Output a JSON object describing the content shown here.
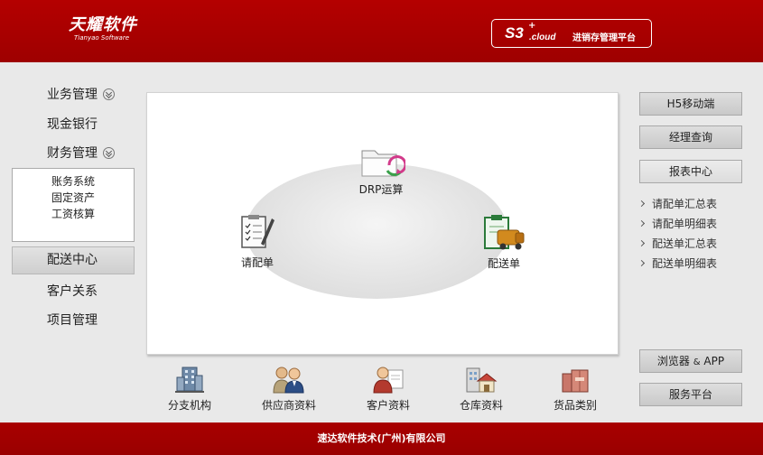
{
  "header": {
    "logo_main": "天耀软件",
    "logo_sub": "Tianyao Software",
    "brand_s3": "S3",
    "brand_plus": "+",
    "brand_cloud": ".cloud",
    "brand_text": "进销存管理平台"
  },
  "nav": {
    "business": "业务管理",
    "cash_bank": "现金银行",
    "finance": "财务管理",
    "finance_sub": [
      "账务系统",
      "固定资产",
      "工资核算"
    ],
    "distribution": "配送中心",
    "customer": "客户关系",
    "project": "项目管理"
  },
  "flow": {
    "drp": "DRP运算",
    "request": "请配单",
    "delivery": "配送单"
  },
  "bottom": {
    "branch": "分支机构",
    "supplier": "供应商资料",
    "customer": "客户资料",
    "warehouse": "仓库资料",
    "goods": "货品类别"
  },
  "right": {
    "h5": "H5移动端",
    "manager": "经理查询",
    "report_center": "报表中心",
    "reports": [
      "请配单汇总表",
      "请配单明细表",
      "配送单汇总表",
      "配送单明细表"
    ],
    "browser": "浏览器",
    "amp": "&",
    "app": "APP",
    "service": "服务平台"
  },
  "footer": {
    "text": "速达软件技术(广州)有限公司"
  }
}
